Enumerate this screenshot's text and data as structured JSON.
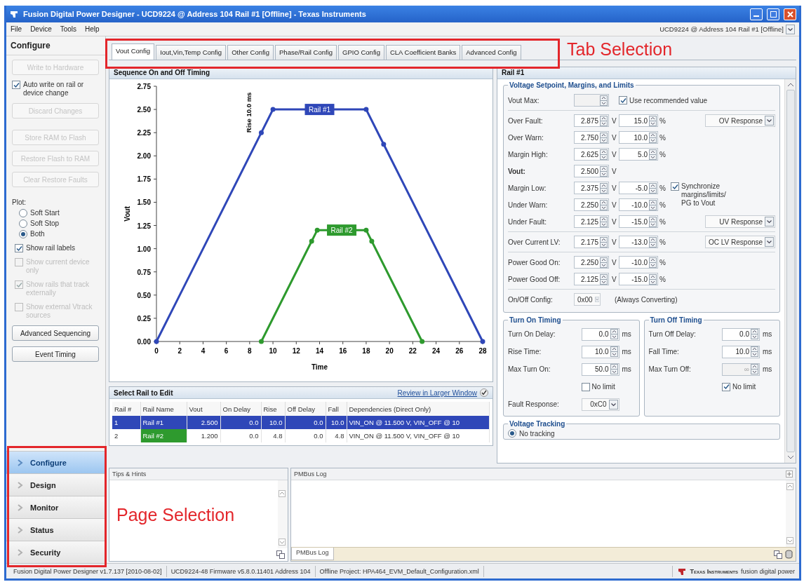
{
  "window": {
    "title": "Fusion Digital Power Designer - UCD9224 @ Address 104 Rail #1 [Offline] - Texas Instruments"
  },
  "menu": [
    "File",
    "Device",
    "Tools",
    "Help"
  ],
  "device_selector": {
    "value": "UCD9224 @ Address 104 Rail #1 [Offline]"
  },
  "sidebar": {
    "title": "Configure",
    "items": [
      {
        "kind": "button",
        "label": "Write to Hardware",
        "disabled": true
      },
      {
        "kind": "checkbox",
        "label": "Auto write on rail or device change",
        "checked": true,
        "disabled": false
      },
      {
        "kind": "button",
        "label": "Discard Changes",
        "disabled": true
      },
      {
        "kind": "button",
        "label": "Store RAM to Flash",
        "disabled": true
      },
      {
        "kind": "button",
        "label": "Restore Flash to RAM",
        "disabled": true
      },
      {
        "kind": "button",
        "label": "Clear Restore Faults",
        "disabled": true
      },
      {
        "kind": "heading",
        "label": "Plot:"
      },
      {
        "kind": "radio",
        "label": "Soft Start",
        "selected": false
      },
      {
        "kind": "radio",
        "label": "Soft Stop",
        "selected": false
      },
      {
        "kind": "radio",
        "label": "Both",
        "selected": true
      },
      {
        "kind": "checkbox",
        "label": "Show rail labels",
        "checked": true,
        "disabled": false
      },
      {
        "kind": "checkbox",
        "label": "Show current device only",
        "checked": false,
        "disabled": true
      },
      {
        "kind": "checkbox",
        "label": "Show rails that track externally",
        "checked": true,
        "disabled": true
      },
      {
        "kind": "checkbox",
        "label": "Show external Vtrack sources",
        "checked": false,
        "disabled": true
      },
      {
        "kind": "button",
        "label": "Advanced Sequencing",
        "disabled": false
      },
      {
        "kind": "button",
        "label": "Event Timing",
        "disabled": false
      }
    ]
  },
  "pages": [
    {
      "label": "Configure",
      "selected": true
    },
    {
      "label": "Design",
      "selected": false
    },
    {
      "label": "Monitor",
      "selected": false
    },
    {
      "label": "Status",
      "selected": false
    },
    {
      "label": "Security",
      "selected": false
    }
  ],
  "tabs": [
    {
      "label": "Vout Config",
      "selected": true
    },
    {
      "label": "Iout,Vin,Temp Config",
      "selected": false
    },
    {
      "label": "Other Config",
      "selected": false
    },
    {
      "label": "Phase/Rail Config",
      "selected": false
    },
    {
      "label": "GPIO Config",
      "selected": false
    },
    {
      "label": "CLA Coefficient Banks",
      "selected": false
    },
    {
      "label": "Advanced Config",
      "selected": false
    }
  ],
  "chart_data": {
    "type": "line",
    "title": "Sequence On and Off Timing",
    "xlabel": "Time",
    "ylabel": "Vout",
    "xlim": [
      0,
      28
    ],
    "ylim": [
      0,
      2.75
    ],
    "xticks": [
      0,
      2,
      4,
      6,
      8,
      10,
      12,
      14,
      16,
      18,
      20,
      22,
      24,
      26,
      28
    ],
    "yticks": [
      {
        "value": 0,
        "label": "0.00"
      },
      {
        "value": 0.25,
        "label": "0.25"
      },
      {
        "value": 0.5,
        "label": "0.50"
      },
      {
        "value": 0.75,
        "label": "0.75"
      },
      {
        "value": 1,
        "label": "1.00"
      },
      {
        "value": 1.25,
        "label": "1.25"
      },
      {
        "value": 1.5,
        "label": "1.50"
      },
      {
        "value": 1.75,
        "label": "1.75"
      },
      {
        "value": 2,
        "label": "2.00"
      },
      {
        "value": 2.25,
        "label": "2.25"
      },
      {
        "value": 2.5,
        "label": "2.50"
      },
      {
        "value": 2.75,
        "label": "2.75"
      }
    ],
    "series": [
      {
        "name": "Rail #1",
        "color": "#2f47b8",
        "marker": "o",
        "x": [
          0,
          9,
          10,
          18,
          19.5,
          28
        ],
        "values": [
          0,
          2.25,
          2.5,
          2.5,
          2.125,
          0
        ]
      },
      {
        "name": "Rail #2",
        "color": "#2e9a2e",
        "marker": "o",
        "x": [
          9,
          13.32,
          13.8,
          18,
          18.48,
          22.8
        ],
        "values": [
          0,
          1.08,
          1.2,
          1.2,
          1.08,
          0
        ]
      }
    ],
    "annotations": [
      "Rise 10.0 ms"
    ]
  },
  "rail_table": {
    "title": "Select Rail to Edit",
    "link": "Review in Larger Window",
    "columns": [
      "Rail #",
      "Rail Name",
      "Vout",
      "On Delay",
      "Rise",
      "Off Delay",
      "Fall",
      "Dependencies (Direct Only)"
    ],
    "rows": [
      {
        "cells": [
          "1",
          "Rail #1",
          "2.500",
          "0.0",
          "10.0",
          "0.0",
          "10.0",
          "VIN_ON @ 11.500 V, VIN_OFF @ 10"
        ],
        "color": "#2f47b8",
        "selected": true
      },
      {
        "cells": [
          "2",
          "Rail #2",
          "1.200",
          "0.0",
          "4.8",
          "0.0",
          "4.8",
          "VIN_ON @ 11.500 V, VIN_OFF @ 10"
        ],
        "color": "#2e9a2e",
        "selected": false
      }
    ]
  },
  "rail_panel": {
    "title": "Rail #1",
    "voltage_group": {
      "title": "Voltage Setpoint, Margins, and Limits",
      "sections": [
        [
          {
            "kind": "max",
            "label": "Vout Max:",
            "check_label": "Use recommended value",
            "checked": true
          }
        ],
        [
          {
            "kind": "limit",
            "label": "Over Fault:",
            "volts": "2.875",
            "volts_unit": "V",
            "percent": "15.0",
            "percent_unit": "%",
            "response": "OV Response"
          },
          {
            "kind": "limit",
            "label": "Over Warn:",
            "volts": "2.750",
            "volts_unit": "V",
            "percent": "10.0",
            "percent_unit": "%"
          },
          {
            "kind": "limit",
            "label": "Margin High:",
            "volts": "2.625",
            "volts_unit": "V",
            "percent": "5.0",
            "percent_unit": "%"
          },
          {
            "kind": "setpoint",
            "label": "Vout:",
            "volts": "2.500",
            "volts_unit": "V"
          },
          {
            "kind": "limit",
            "label": "Margin Low:",
            "volts": "2.375",
            "volts_unit": "V",
            "percent": "-5.0",
            "percent_unit": "%"
          },
          {
            "kind": "limit",
            "label": "Under Warn:",
            "volts": "2.250",
            "volts_unit": "V",
            "percent": "-10.0",
            "percent_unit": "%"
          },
          {
            "kind": "limit",
            "label": "Under Fault:",
            "volts": "2.125",
            "volts_unit": "V",
            "percent": "-15.0",
            "percent_unit": "%",
            "response": "UV Response"
          }
        ],
        [
          {
            "kind": "limit",
            "label": "Over Current LV:",
            "volts": "2.175",
            "volts_unit": "V",
            "percent": "-13.0",
            "percent_unit": "%",
            "response": "OC LV Response"
          }
        ],
        [
          {
            "kind": "limit",
            "label": "Power Good On:",
            "volts": "2.250",
            "volts_unit": "V",
            "percent": "-10.0",
            "percent_unit": "%"
          },
          {
            "kind": "limit",
            "label": "Power Good Off:",
            "volts": "2.125",
            "volts_unit": "V",
            "percent": "-15.0",
            "percent_unit": "%"
          }
        ],
        [
          {
            "kind": "config",
            "label": "On/Off Config:",
            "value": "0x00",
            "note": "(Always Converting)"
          }
        ]
      ],
      "sync": {
        "label": "Synchronize margins/limits/ PG to Vout",
        "checked": true
      }
    },
    "timing_groups": [
      {
        "title": "Turn On Timing",
        "rows": [
          {
            "label": "Turn On Delay:",
            "value": "0.0",
            "unit": "ms",
            "disabled": false
          },
          {
            "label": "Rise Time:",
            "value": "10.0",
            "unit": "ms",
            "disabled": false
          },
          {
            "label": "Max Turn On:",
            "value": "50.0",
            "unit": "ms",
            "disabled": false
          }
        ],
        "no_limit": {
          "label": "No limit",
          "checked": false
        },
        "fault_response": {
          "label": "Fault Response:",
          "value": "0xC0"
        }
      },
      {
        "title": "Turn Off Timing",
        "rows": [
          {
            "label": "Turn Off Delay:",
            "value": "0.0",
            "unit": "ms",
            "disabled": false
          },
          {
            "label": "Fall Time:",
            "value": "10.0",
            "unit": "ms",
            "disabled": false
          },
          {
            "label": "Max Turn Off:",
            "value": "∞",
            "unit": "ms",
            "disabled": true
          }
        ],
        "no_limit": {
          "label": "No limit",
          "checked": true
        }
      }
    ],
    "tracking_group": {
      "title": "Voltage Tracking",
      "options": [
        {
          "label": "No tracking",
          "selected": true
        }
      ]
    }
  },
  "tips_panel": {
    "title": "Tips & Hints"
  },
  "log_panel": {
    "title": "PMBus Log",
    "tabs": [
      {
        "label": "PMBus Log",
        "selected": true
      }
    ]
  },
  "status_bar": {
    "sections": [
      "Fusion Digital Power Designer v1.7.137 [2010-08-02]",
      "UCD9224-48 Firmware v5.8.0.11401 Address 104",
      "Offline Project: HPA464_EVM_Default_Configuration.xml"
    ],
    "brand": "Texas Instruments",
    "tagline": "fusion digital power"
  },
  "annotations": [
    {
      "text": "Tab Selection"
    },
    {
      "text": "Page Selection"
    }
  ]
}
